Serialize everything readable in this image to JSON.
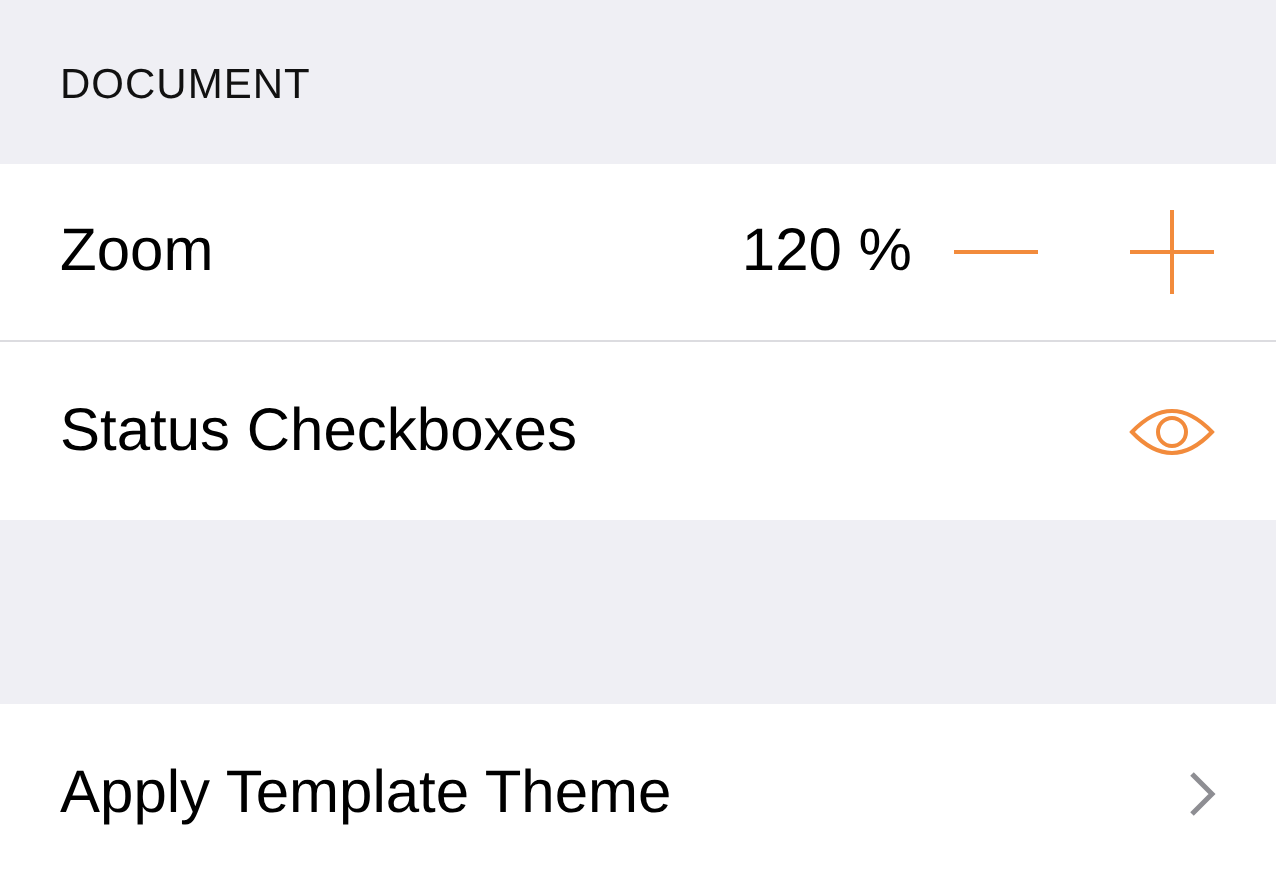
{
  "section_header": "DOCUMENT",
  "rows": [
    {
      "kind": "stepper",
      "label": "Zoom",
      "value": "120 %"
    },
    {
      "kind": "eye",
      "label": "Status Checkboxes"
    }
  ],
  "second_section_rows": [
    {
      "kind": "disclosure",
      "label": "Apply Template Theme"
    }
  ]
}
